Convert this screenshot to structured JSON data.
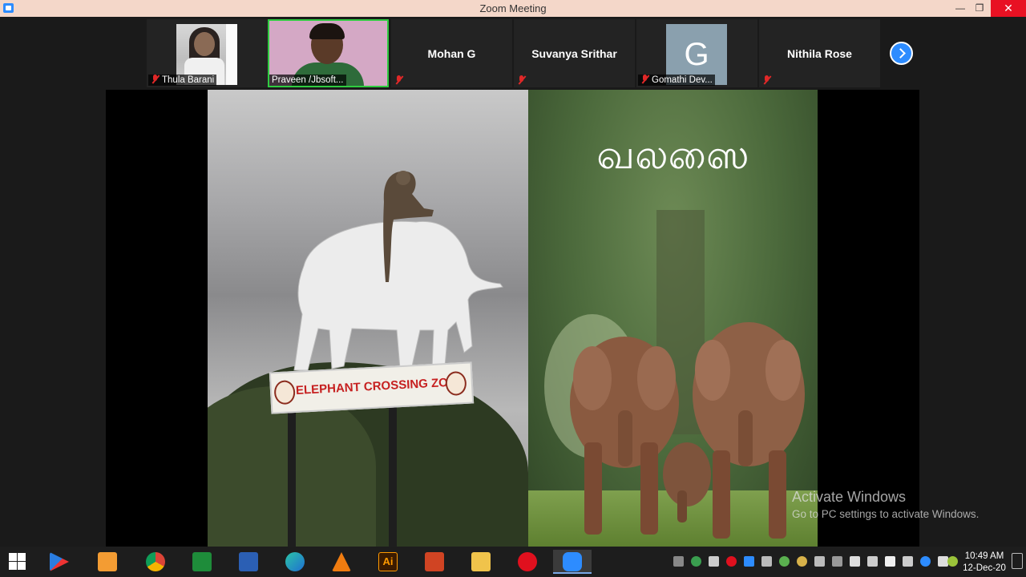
{
  "window": {
    "title": "Zoom Meeting",
    "minimize": "—",
    "maximize": "❐",
    "close": "✕"
  },
  "participants": [
    {
      "name": "Thula Barani",
      "muted": true,
      "video": true
    },
    {
      "name": "Praveen /Jbsoft...",
      "muted": true,
      "video": true,
      "speaking": true
    },
    {
      "name": "Mohan G",
      "muted": true,
      "video": false
    },
    {
      "name": "Suvanya Srithar",
      "muted": true,
      "video": false
    },
    {
      "name": "Gomathi Dev...",
      "muted": true,
      "video": false,
      "avatar_letter": "G"
    },
    {
      "name": "Nithila Rose",
      "muted": true,
      "video": false
    }
  ],
  "share": {
    "sign_text": "ELEPHANT CROSSING ZONE",
    "tamil_word": "வலஸை"
  },
  "watermark": {
    "line1": "Activate Windows",
    "line2": "Go to PC settings to activate Windows."
  },
  "taskbar": {
    "apps": [
      "windows-start",
      "media-player",
      "video-player",
      "chrome",
      "excel",
      "word",
      "edge",
      "vlc",
      "illustrator",
      "powerpoint",
      "file-explorer",
      "opera",
      "zoom"
    ],
    "active_app": "zoom",
    "illustrator_label": "Ai",
    "clock_time": "10:49 AM",
    "clock_date": "12-Dec-20"
  },
  "colors": {
    "titlebar": "#f4d7c9",
    "close_button": "#e81123",
    "zoom_blue": "#2d8cff",
    "active_speaker": "#2fcc40",
    "muted_red": "#e02828"
  }
}
